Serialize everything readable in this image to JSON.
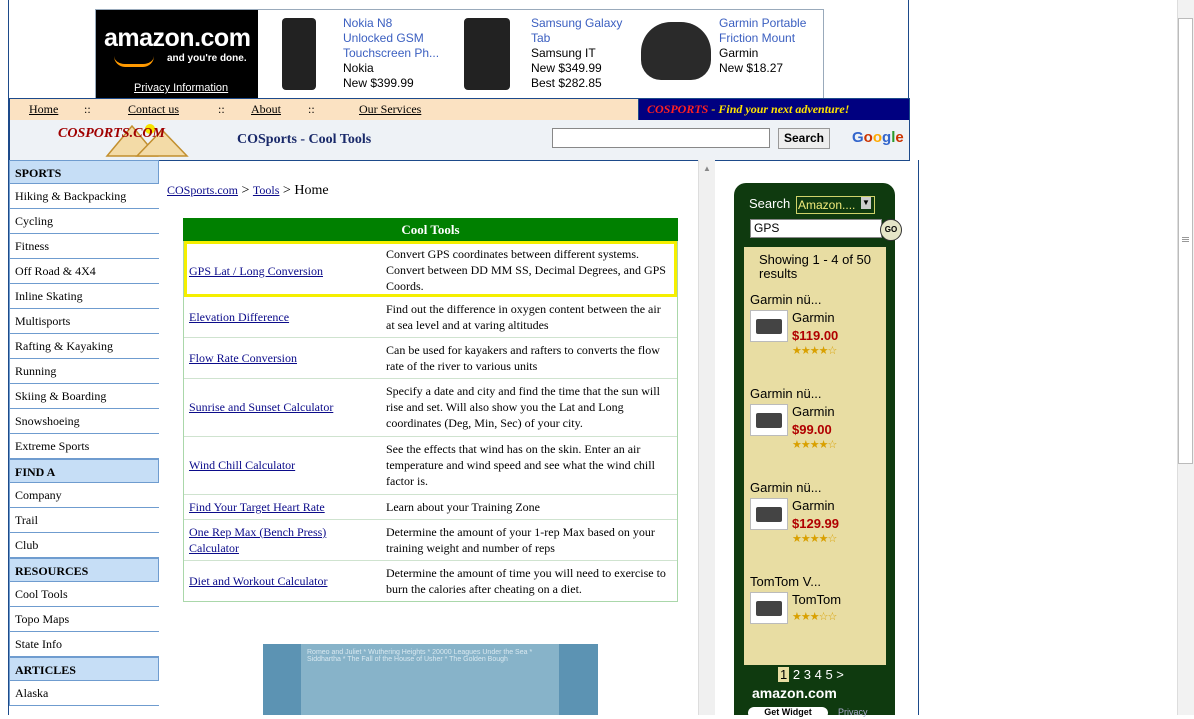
{
  "ad": {
    "privacy": "Privacy Information",
    "logo_main": "amazon.com",
    "logo_tag": "and you're done.",
    "products": [
      {
        "title": "Nokia N8 Unlocked GSM Touchscreen Ph...",
        "brand": "Nokia",
        "price": "New $399.99"
      },
      {
        "title": "Samsung Galaxy Tab",
        "brand": "Samsung IT",
        "price": "New $349.99",
        "best": "Best $282.85"
      },
      {
        "title": "Garmin Portable Friction Mount",
        "brand": "Garmin",
        "price": "New $18.27"
      }
    ]
  },
  "nav": {
    "items": [
      "Home",
      "Contact us",
      "About",
      "Our Services"
    ],
    "sep": "::",
    "tagline_brand": "COSPORTS",
    "tagline_rest": " - Find your next adventure!"
  },
  "header": {
    "logo": "COSPORTS.COM",
    "title": "COSports - Cool Tools",
    "search_button": "Search",
    "google": "Google"
  },
  "sidebar": [
    {
      "category": "SPORTS",
      "items": [
        "Hiking & Backpacking",
        "Cycling",
        "Fitness",
        "Off Road & 4X4",
        "Inline Skating",
        "Multisports",
        "Rafting & Kayaking",
        "Running",
        "Skiing & Boarding",
        "Snowshoeing",
        "Extreme Sports"
      ]
    },
    {
      "category": "FIND A",
      "items": [
        "Company",
        "Trail",
        "Club"
      ]
    },
    {
      "category": "RESOURCES",
      "items": [
        "Cool Tools",
        "Topo Maps",
        "State Info"
      ]
    },
    {
      "category": "ARTICLES",
      "items": [
        "Alaska"
      ]
    }
  ],
  "breadcrumb": {
    "link1": "COSports.com",
    "sep": " > ",
    "link2": "Tools",
    "current": "Home"
  },
  "tools": {
    "heading": "Cool Tools",
    "rows": [
      {
        "name": "GPS Lat / Long Conversion",
        "desc": "Convert GPS coordinates between different systems. Convert between DD MM SS, Decimal Degrees, and GPS Coords."
      },
      {
        "name": "Elevation Difference",
        "desc": "Find out the difference in oxygen content between the air at sea level and at varing altitudes"
      },
      {
        "name": "Flow Rate Conversion",
        "desc": "Can be used for kayakers and rafters to converts the flow rate of the river to various units"
      },
      {
        "name": "Sunrise and Sunset Calculator",
        "desc": "Specify a date and city and find the time that the sun will rise and set. Will also show you the Lat and Long coordinates (Deg, Min, Sec) of your city."
      },
      {
        "name": "Wind Chill Calculator",
        "desc": "See the effects that wind has on the skin. Enter an air temperature and wind speed and see what the wind chill factor is."
      },
      {
        "name": "Find Your Target Heart Rate",
        "desc": "Learn about your Training Zone"
      },
      {
        "name": "One Rep Max (Bench Press) Calculator",
        "desc": "Determine the amount of your 1-rep Max based on your training weight and number of reps"
      },
      {
        "name": "Diet and Workout Calculator",
        "desc": "Determine the amount of time you will need to exercise to burn the calories after cheating on a diet."
      }
    ]
  },
  "bottom_ad": {
    "text": "Romeo and Juliet * Wuthering Heights * 20000 Leagues Under the Sea * Siddhartha * The Fall of the House of Usher * The Golden Bough"
  },
  "widget": {
    "search_label": "Search",
    "category": "Amazon....",
    "query": "GPS",
    "go": "GO",
    "count": "Showing 1 - 4 of 50 results",
    "results": [
      {
        "title": "Garmin nü...",
        "brand": "Garmin",
        "price": "$119.00",
        "rating": 4
      },
      {
        "title": "Garmin nü...",
        "brand": "Garmin",
        "price": "$99.00",
        "rating": 4.5
      },
      {
        "title": "Garmin nü...",
        "brand": "Garmin",
        "price": "$129.99",
        "rating": 4
      },
      {
        "title": "TomTom V...",
        "brand": "TomTom",
        "price": "",
        "rating": 3.5
      }
    ],
    "pages": [
      "1",
      "2",
      "3",
      "4",
      "5",
      ">"
    ],
    "amazon": "amazon.com",
    "get_widget": "Get Widget",
    "privacy": "Privacy"
  }
}
